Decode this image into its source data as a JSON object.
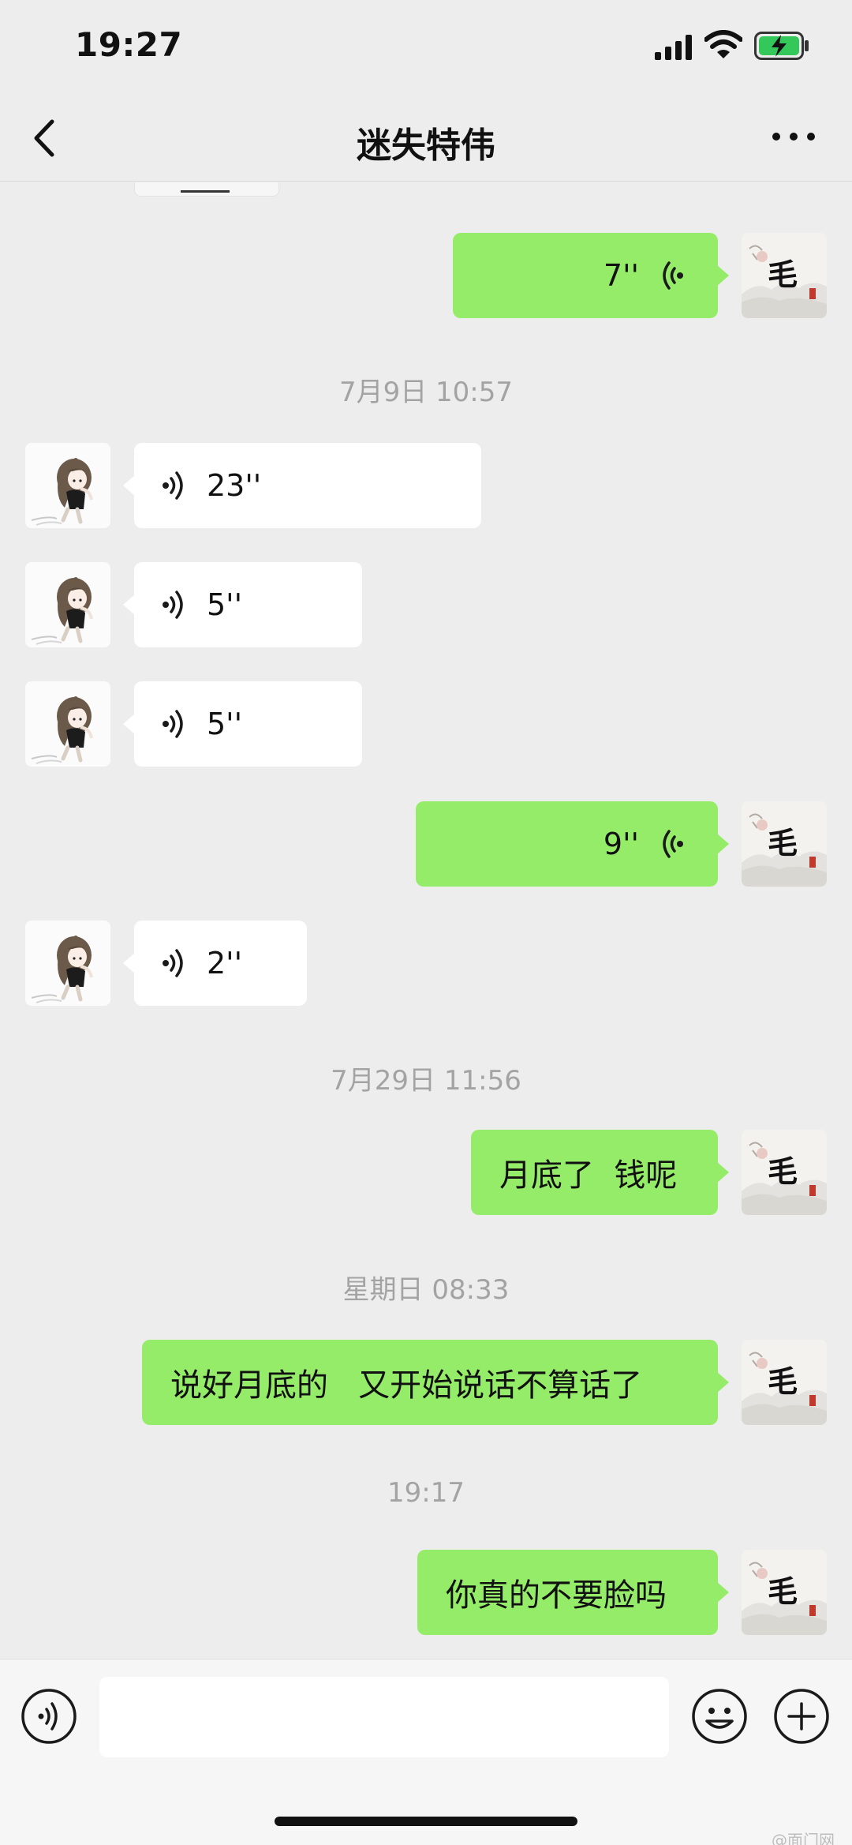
{
  "status_bar": {
    "time": "19:27"
  },
  "header": {
    "title": "迷失特伟"
  },
  "messages": {
    "m1": {
      "duration": "7''"
    },
    "ts1": "7月9日 10:57",
    "m2": {
      "duration": "23''"
    },
    "m3": {
      "duration": "5''"
    },
    "m4": {
      "duration": "5''"
    },
    "m5": {
      "duration": "9''"
    },
    "m6": {
      "duration": "2''"
    },
    "ts2": "7月29日 11:56",
    "m7": {
      "text": "月底了  钱呢"
    },
    "ts3": "星期日 08:33",
    "m8": {
      "text": "说好月底的   又开始说话不算话了"
    },
    "ts4": "19:17",
    "m9": {
      "text": "你真的不要脸吗"
    }
  },
  "avatars": {
    "self_char": "毛",
    "self_seal": "印"
  },
  "input": {
    "value": "",
    "placeholder": ""
  },
  "watermark": "@面门网"
}
